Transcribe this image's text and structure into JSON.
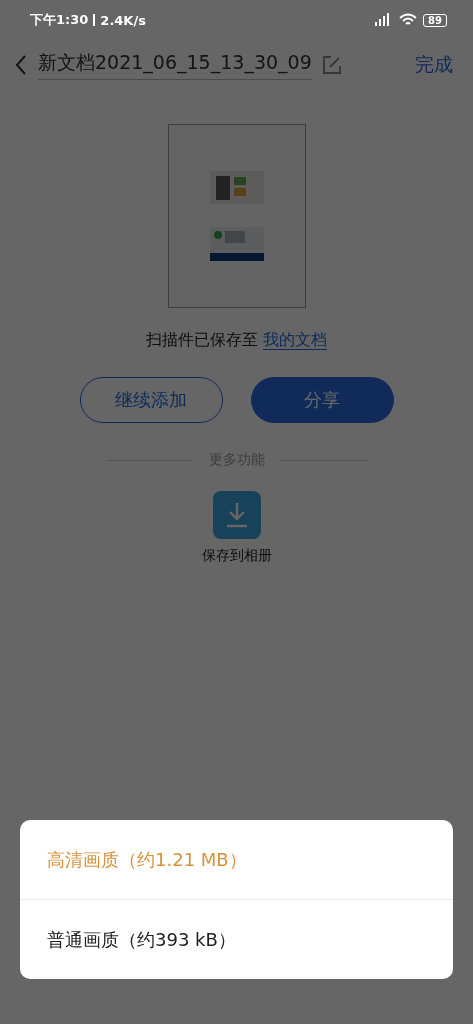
{
  "status_bar": {
    "time": "下午1:30",
    "speed": "2.4K/s",
    "battery": "89"
  },
  "header": {
    "title": "新文档2021_06_15_13_30_09",
    "done": "完成"
  },
  "saved_note": {
    "text": "扫描件已保存至",
    "link": "我的文档"
  },
  "buttons": [
    {
      "label": "继续添加",
      "kind": "outline"
    },
    {
      "label": "分享",
      "kind": "filled"
    }
  ],
  "more": {
    "title": "更多功能",
    "actions": [
      {
        "label": "保存到相册"
      }
    ]
  },
  "sheet": {
    "options": [
      {
        "label": "高清画质（约1.21 MB）",
        "selected": true
      },
      {
        "label": "普通画质（约393 kB）",
        "selected": false
      }
    ]
  }
}
